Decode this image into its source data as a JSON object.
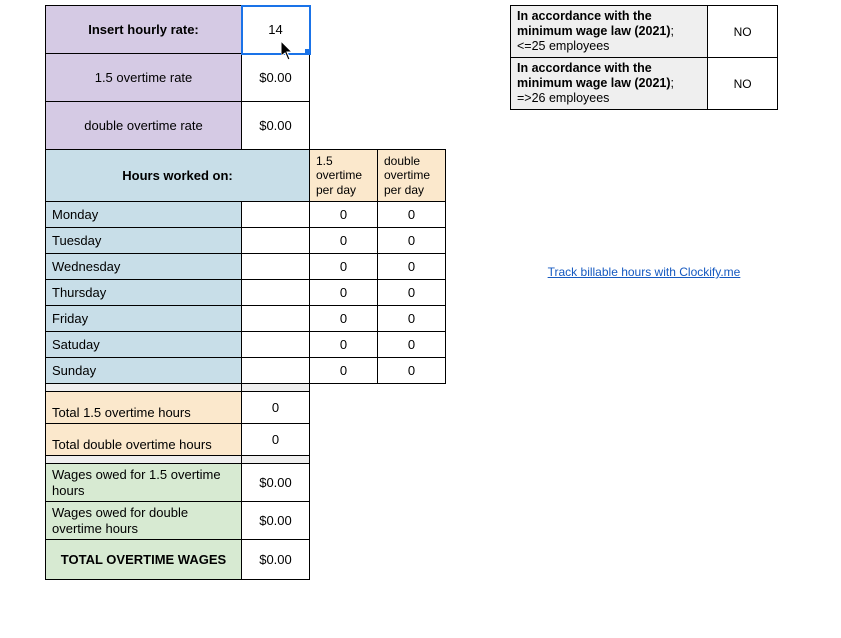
{
  "rates": {
    "hourly_label": "Insert hourly rate:",
    "hourly_value": "14",
    "ot15_label": "1.5 overtime rate",
    "ot15_value": "$0.00",
    "ot2_label": "double overtime rate",
    "ot2_value": "$0.00"
  },
  "hours_header": {
    "worked_on": "Hours worked on:",
    "col_ot15": "1.5 overtime per day",
    "col_ot2": "double overtime per day"
  },
  "days": [
    {
      "name": "Monday",
      "ot15": "0",
      "ot2": "0"
    },
    {
      "name": "Tuesday",
      "ot15": "0",
      "ot2": "0"
    },
    {
      "name": "Wednesday",
      "ot15": "0",
      "ot2": "0"
    },
    {
      "name": "Thursday",
      "ot15": "0",
      "ot2": "0"
    },
    {
      "name": "Friday",
      "ot15": "0",
      "ot2": "0"
    },
    {
      "name": "Satuday",
      "ot15": "0",
      "ot2": "0"
    },
    {
      "name": "Sunday",
      "ot15": "0",
      "ot2": "0"
    }
  ],
  "totals": {
    "tot15_label": "Total 1.5 overtime hours",
    "tot15_value": "0",
    "tot2_label": "Total double overtime hours",
    "tot2_value": "0"
  },
  "wages": {
    "w15_label": "Wages owed for 1.5 overtime hours",
    "w15_value": "$0.00",
    "w2_label": "Wages owed for double overtime hours",
    "w2_value": "$0.00",
    "total_label": "TOTAL OVERTIME WAGES",
    "total_value": "$0.00"
  },
  "compliance": {
    "row1_a": "In accordance with the minimum wage law (2021)",
    "row1_b": "; <=25 employees",
    "row1_ans": "NO",
    "row2_a": "In accordance with the minimum wage law (2021)",
    "row2_b": "; =>26 employees",
    "row2_ans": "NO"
  },
  "link": {
    "text": "Track billable hours with Clockify.me"
  }
}
